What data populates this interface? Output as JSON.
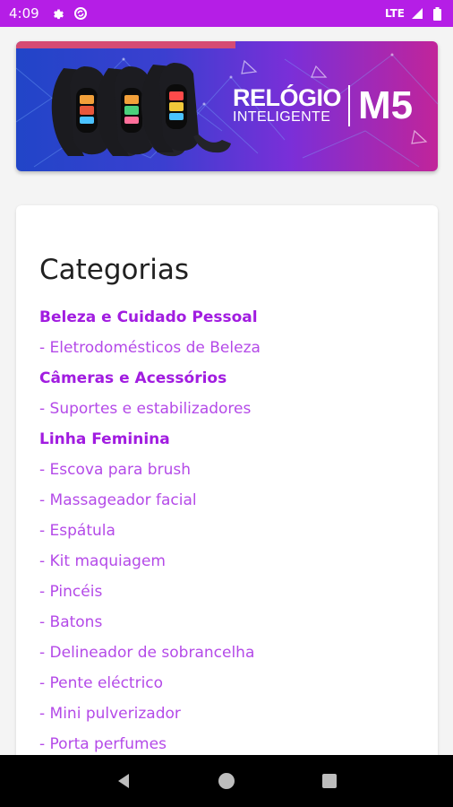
{
  "status_bar": {
    "time": "4:09",
    "network": "LTE",
    "icons": [
      "gear-icon",
      "sync-icon",
      "signal-icon",
      "battery-icon"
    ],
    "background": "#b51ee6"
  },
  "banner": {
    "title_line1": "RELÓGIO",
    "title_line2": "INTELIGENTE",
    "model": "M5"
  },
  "categories": {
    "title": "Categorias",
    "items": [
      {
        "label": "Beleza e Cuidado Pessoal",
        "level": "parent"
      },
      {
        "label": "- Eletrodomésticos de Beleza",
        "level": "child"
      },
      {
        "label": "Câmeras e Acessórios",
        "level": "parent"
      },
      {
        "label": "- Suportes e estabilizadores",
        "level": "child"
      },
      {
        "label": "Linha Feminina",
        "level": "parent"
      },
      {
        "label": "- Escova para brush",
        "level": "child"
      },
      {
        "label": "- Massageador facial",
        "level": "child"
      },
      {
        "label": "- Espátula",
        "level": "child"
      },
      {
        "label": "- Kit maquiagem",
        "level": "child"
      },
      {
        "label": "- Pincéis",
        "level": "child"
      },
      {
        "label": "- Batons",
        "level": "child"
      },
      {
        "label": "- Delineador de sobrancelha",
        "level": "child"
      },
      {
        "label": "- Pente eléctrico",
        "level": "child"
      },
      {
        "label": "- Mini pulverizador",
        "level": "child"
      },
      {
        "label": "- Porta perfumes",
        "level": "child"
      }
    ]
  },
  "colors": {
    "accent_parent": "#a11ce0",
    "accent_child": "#b44ae8"
  },
  "nav_bar": {
    "buttons": [
      "back-icon",
      "home-icon",
      "recents-icon"
    ]
  }
}
